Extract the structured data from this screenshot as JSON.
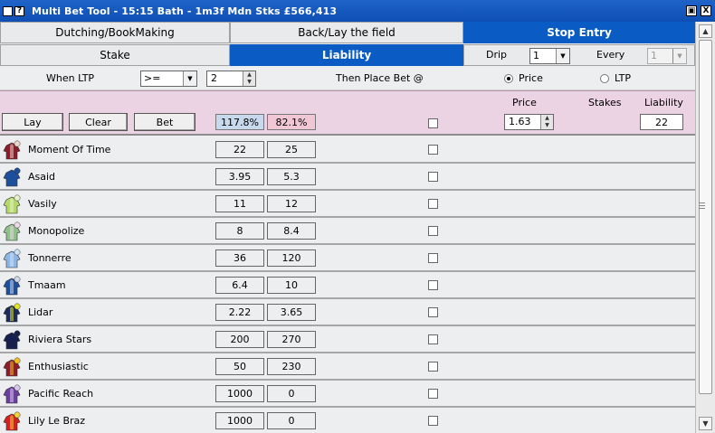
{
  "window": {
    "title": "Multi Bet Tool - 15:15  Bath - 1m3f Mdn Stks   £566,413",
    "help_glyph": "?",
    "restore_glyph": "▣",
    "close_glyph": "X"
  },
  "tabs_row1": [
    {
      "label": "Dutching/BookMaking",
      "active": false
    },
    {
      "label": "Back/Lay the field",
      "active": false
    },
    {
      "label": "Stop Entry",
      "active": true
    }
  ],
  "tabs_row2": {
    "stake": "Stake",
    "liability": "Liability",
    "drip_label": "Drip",
    "drip_value": "1",
    "every_label": "Every",
    "every_value": "1"
  },
  "ltp": {
    "when_label": "When LTP",
    "operator": ">=",
    "value": "2",
    "then_label": "Then Place Bet @",
    "price_label": "Price",
    "ltp_label": "LTP",
    "selected": "Price"
  },
  "controls": {
    "lay": "Lay",
    "clear": "Clear",
    "bet": "Bet",
    "back_pct": "117.8%",
    "lay_pct": "82.1%",
    "price_header": "Price",
    "stakes_header": "Stakes",
    "liability_header": "Liability",
    "price_value": "1.63",
    "liability_value": "22"
  },
  "runners": [
    {
      "name": "Moment Of Time",
      "back": "22",
      "lay": "25",
      "silk_colors": [
        "#8a1c2c",
        "#e8d8c8"
      ]
    },
    {
      "name": "Asaid",
      "back": "3.95",
      "lay": "5.3",
      "silk_colors": [
        "#1d4f9c",
        "#1d4f9c"
      ]
    },
    {
      "name": "Vasily",
      "back": "11",
      "lay": "12",
      "silk_colors": [
        "#b6d86a",
        "#e9f4c8"
      ]
    },
    {
      "name": "Monopolize",
      "back": "8",
      "lay": "8.4",
      "silk_colors": [
        "#8fc28a",
        "#f1d7e8"
      ]
    },
    {
      "name": "Tonnerre",
      "back": "36",
      "lay": "120",
      "silk_colors": [
        "#8db6e6",
        "#cfe3f8"
      ]
    },
    {
      "name": "Tmaam",
      "back": "6.4",
      "lay": "10",
      "silk_colors": [
        "#1d4f9c",
        "#cfd8e8"
      ]
    },
    {
      "name": "Lidar",
      "back": "2.22",
      "lay": "3.65",
      "silk_colors": [
        "#1a2a5e",
        "#e2e62a"
      ]
    },
    {
      "name": "Riviera Stars",
      "back": "200",
      "lay": "270",
      "silk_colors": [
        "#16204e",
        "#16204e"
      ]
    },
    {
      "name": "Enthusiastic",
      "back": "50",
      "lay": "230",
      "silk_colors": [
        "#8a1c2c",
        "#f0c020"
      ]
    },
    {
      "name": "Pacific Reach",
      "back": "1000",
      "lay": "0",
      "silk_colors": [
        "#6a3f9e",
        "#d8c8ef"
      ]
    },
    {
      "name": "Lily Le Braz",
      "back": "1000",
      "lay": "0",
      "silk_colors": [
        "#d32020",
        "#f3d23a"
      ]
    }
  ],
  "colors": {
    "accent_blue": "#0a5bc4",
    "back_pct_bg": "#c8d9ee",
    "lay_pct_bg": "#f1c7d6",
    "pink_band": "#ecd3e4"
  }
}
